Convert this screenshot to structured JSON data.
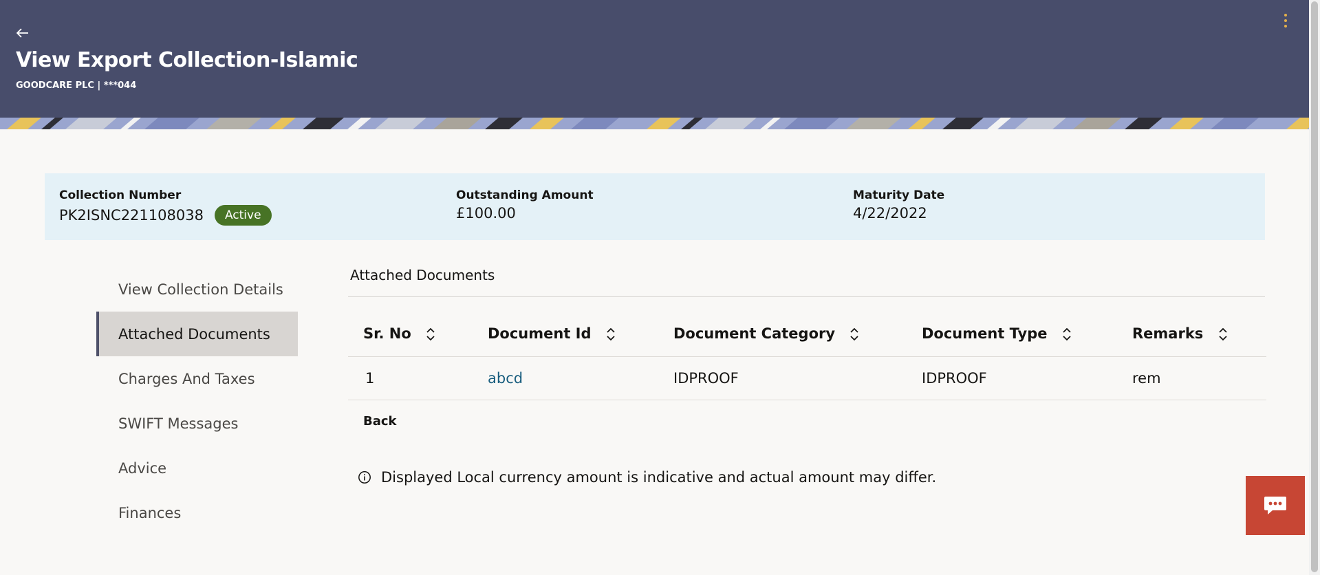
{
  "header": {
    "back_icon": "arrow-left-icon",
    "title": "View Export Collection-Islamic",
    "subtitle": "GOODCARE PLC | ***044",
    "menu_icon": "kebab-menu-icon",
    "background": "#484d6b"
  },
  "summary": {
    "collection_number_label": "Collection Number",
    "collection_number": "PK2ISNC221108038",
    "status": "Active",
    "outstanding_amount_label": "Outstanding Amount",
    "outstanding_amount": "£100.00",
    "maturity_date_label": "Maturity Date",
    "maturity_date": "4/22/2022"
  },
  "sidebar": {
    "items": [
      {
        "label": "View Collection Details",
        "active": false
      },
      {
        "label": "Attached Documents",
        "active": true
      },
      {
        "label": "Charges And Taxes",
        "active": false
      },
      {
        "label": "SWIFT Messages",
        "active": false
      },
      {
        "label": "Advice",
        "active": false
      },
      {
        "label": "Finances",
        "active": false
      }
    ]
  },
  "main": {
    "section_title": "Attached Documents",
    "table": {
      "columns": [
        "Sr. No",
        "Document Id",
        "Document Category",
        "Document Type",
        "Remarks"
      ],
      "rows": [
        {
          "sr_no": "1",
          "document_id": "abcd",
          "document_category": "IDPROOF",
          "document_type": "IDPROOF",
          "remarks": "rem"
        }
      ]
    },
    "back_label": "Back",
    "info_icon": "info-circle-icon",
    "info_text": "Displayed Local currency amount is indicative and actual amount may differ."
  },
  "chat": {
    "icon": "chat-bubble-icon",
    "color": "#c74634"
  },
  "colors": {
    "accent": "#185d7e",
    "status_active": "#477325",
    "summary_bg": "#e4f1f7"
  }
}
